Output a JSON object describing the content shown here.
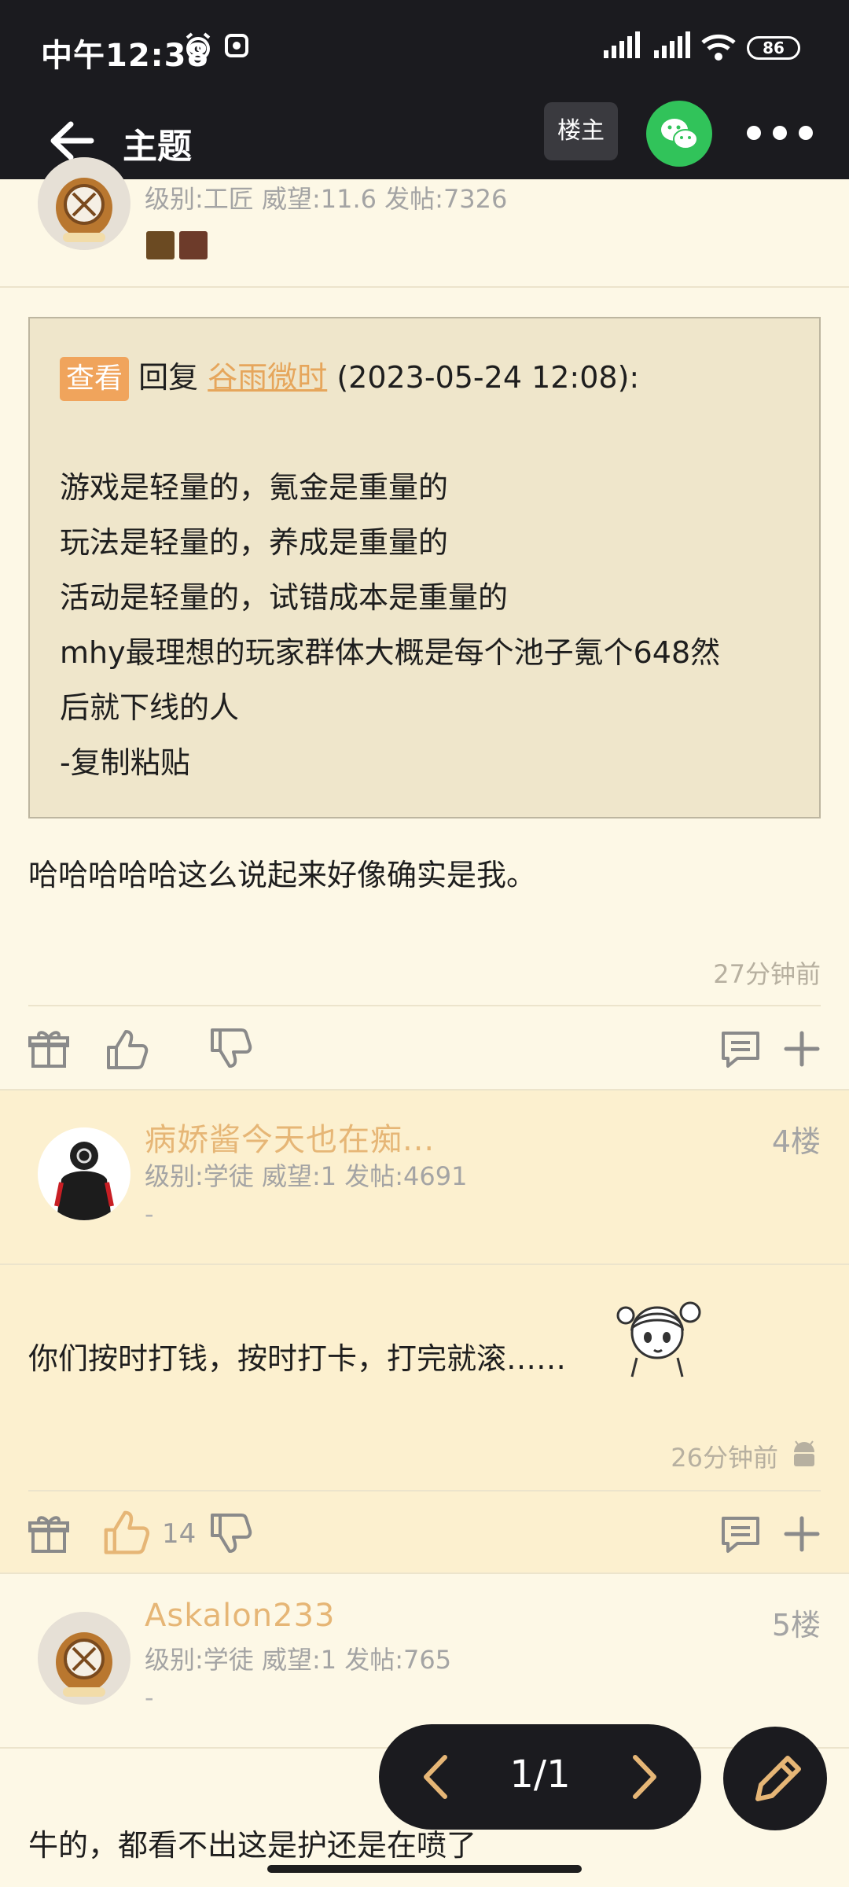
{
  "status_bar": {
    "time": "中午12:38",
    "battery": "86"
  },
  "header": {
    "title": "主题",
    "op_label": "楼主"
  },
  "post3": {
    "info": "级别:工匠 威望:11.6 发帖:7326",
    "quote": {
      "view_tag": "查看",
      "reply_word": "回复",
      "reply_user": "谷雨微时",
      "reply_time": "(2023-05-24 12:08):",
      "lines": [
        "游戏是轻量的，氪金是重量的",
        "玩法是轻量的，养成是重量的",
        "活动是轻量的，试错成本是重量的",
        "mhy最理想的玩家群体大概是每个池子氪个648然",
        "后就下线的人",
        "-复制粘贴"
      ]
    },
    "text": "哈哈哈哈哈这么说起来好像确实是我。",
    "time": "27分钟前"
  },
  "post4": {
    "username": "病娇酱今天也在痴...",
    "floor": "4楼",
    "info": "级别:学徒 威望:1 发帖:4691",
    "signature": "-",
    "text": "你们按时打钱，按时打卡，打完就滚……",
    "time": "26分钟前",
    "likes": "14"
  },
  "post5": {
    "username": "Askalon233",
    "floor": "5楼",
    "info": "级别:学徒 威望:1 发帖:765",
    "signature": "-",
    "text": "牛的，都看不出这是护还是在喷了"
  },
  "pager": {
    "label": "1/1"
  },
  "colors": {
    "accent": "#e6b676",
    "bar": "#1b1b1f",
    "wechat": "#31c35a",
    "quote_bg": "#efe6cb"
  },
  "icons": [
    "back-arrow-icon",
    "wechat-icon",
    "more-icon",
    "gift-icon",
    "thumb-up-icon",
    "thumb-down-icon",
    "comment-icon",
    "plus-icon",
    "android-icon",
    "chevron-left-icon",
    "chevron-right-icon",
    "pencil-icon"
  ]
}
